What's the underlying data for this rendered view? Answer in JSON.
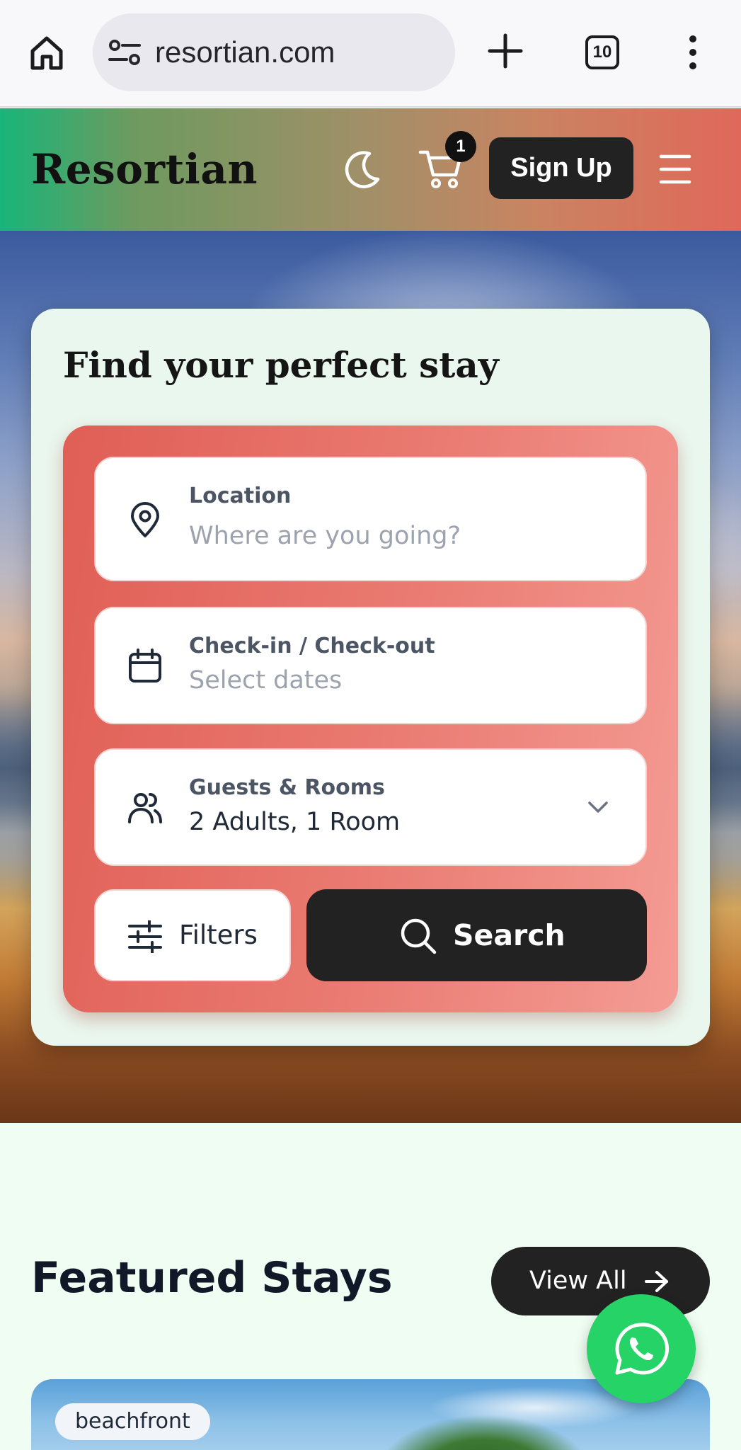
{
  "browser": {
    "url": "resortian.com",
    "tab_count": "10",
    "icons": [
      "home-icon",
      "site-settings-icon",
      "new-tab-icon",
      "tab-switcher-icon",
      "more-menu-icon"
    ]
  },
  "header": {
    "brand": "Resortian",
    "cart_count": "1",
    "signup_label": "Sign Up",
    "icons": [
      "moon-icon",
      "cart-icon",
      "hamburger-menu-icon"
    ]
  },
  "search": {
    "title": "Find your perfect stay",
    "location": {
      "label": "Location",
      "placeholder": "Where are you going?"
    },
    "dates": {
      "label": "Check-in / Check-out",
      "placeholder": "Select dates"
    },
    "guests": {
      "label": "Guests & Rooms",
      "value": "2 Adults, 1 Room"
    },
    "filters_label": "Filters",
    "search_label": "Search"
  },
  "featured": {
    "title": "Featured Stays",
    "view_all_label": "View All",
    "cards": [
      {
        "tag": "beachfront"
      }
    ]
  },
  "colors": {
    "header_gradient_start": "#18b57a",
    "header_gradient_end": "#e0685a",
    "panel_gradient_start": "#e05e55",
    "panel_gradient_end": "#f49c94",
    "dark_button": "#222222",
    "whatsapp": "#25d366",
    "page_background": "#f0fdf2"
  }
}
